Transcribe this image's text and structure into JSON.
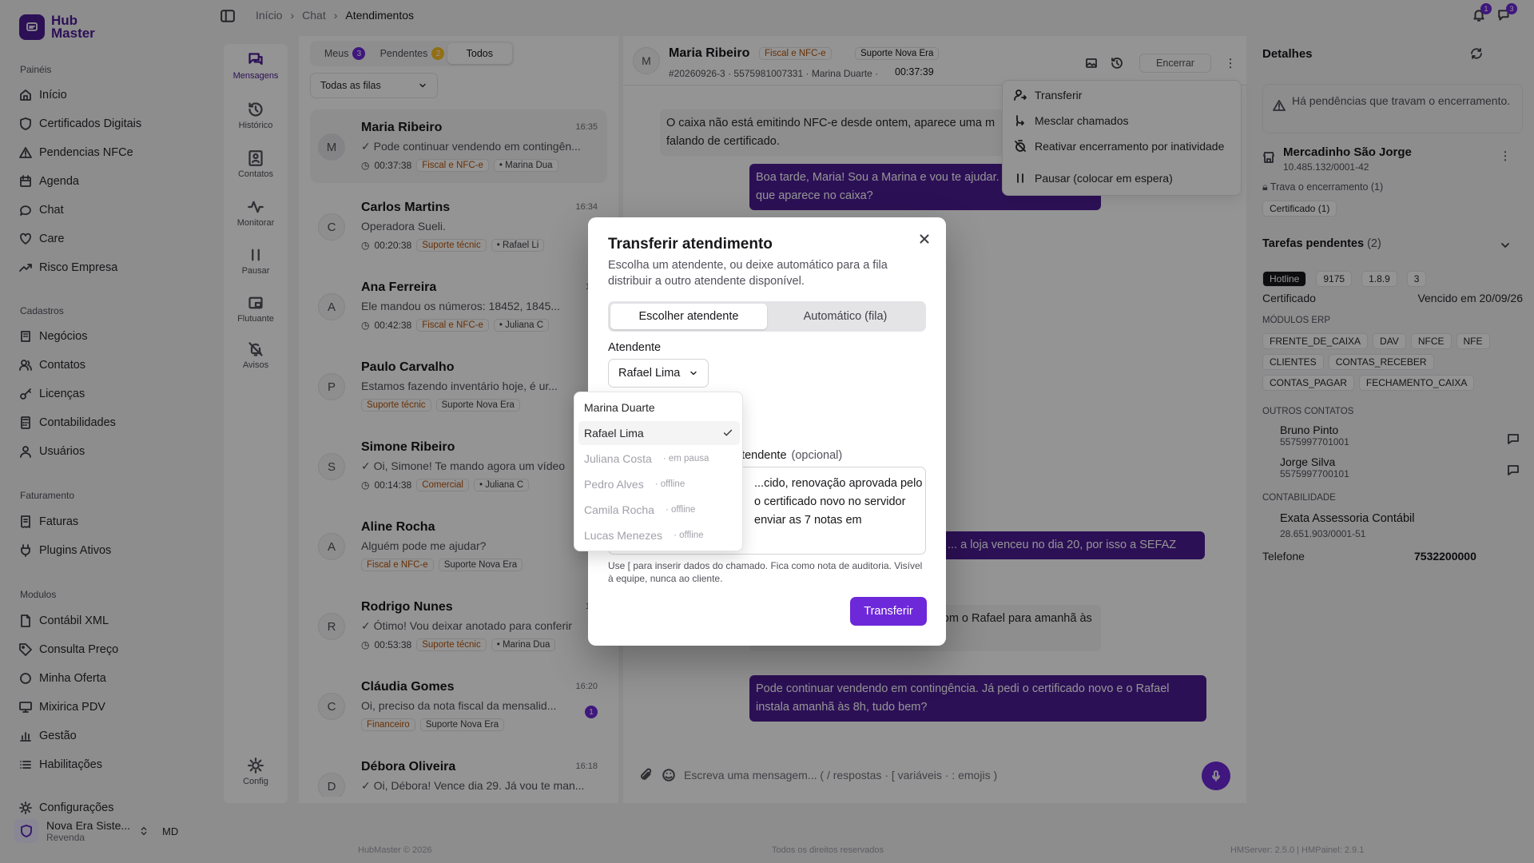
{
  "brand": {
    "line1": "Hub",
    "line2": "Master"
  },
  "sidebar": {
    "sections": [
      {
        "title": "Painéis",
        "items": [
          {
            "label": "Início",
            "icon": "home-icon"
          },
          {
            "label": "Certificados Digitais",
            "icon": "shield-icon"
          },
          {
            "label": "Pendencias NFCe",
            "icon": "alert-icon"
          },
          {
            "label": "Agenda",
            "icon": "calendar-icon"
          },
          {
            "label": "Chat",
            "icon": "chat-icon"
          },
          {
            "label": "Care",
            "icon": "heart-icon"
          },
          {
            "label": "Risco Empresa",
            "icon": "trend-icon"
          }
        ]
      },
      {
        "title": "Cadastros",
        "items": [
          {
            "label": "Negócios",
            "icon": "building-icon"
          },
          {
            "label": "Contatos",
            "icon": "users-icon"
          },
          {
            "label": "Licenças",
            "icon": "key-icon"
          },
          {
            "label": "Contabilidades",
            "icon": "calculator-icon"
          },
          {
            "label": "Usuários",
            "icon": "user-icon"
          }
        ]
      },
      {
        "title": "Faturamento",
        "items": [
          {
            "label": "Faturas",
            "icon": "receipt-icon"
          },
          {
            "label": "Plugins Ativos",
            "icon": "plug-icon"
          }
        ]
      },
      {
        "title": "Modulos",
        "items": [
          {
            "label": "Contábil XML",
            "icon": "file-icon"
          },
          {
            "label": "Consulta Preço",
            "icon": "tag-icon"
          },
          {
            "label": "Minha Oferta",
            "icon": "gift-icon"
          },
          {
            "label": "Mixirica PDV",
            "icon": "monitor-icon"
          },
          {
            "label": "Gestão",
            "icon": "chart-icon"
          },
          {
            "label": "Habilitações",
            "icon": "list-icon"
          },
          {
            "label": "Configurações",
            "icon": "gear-icon"
          }
        ]
      }
    ],
    "workspace": {
      "name": "Nova Era Siste...",
      "role": "Revenda",
      "initials": "MD"
    }
  },
  "topbar": {
    "crumbs": [
      "Início",
      "Chat",
      "Atendimentos"
    ],
    "notif_count": "1",
    "msg_count": "3"
  },
  "rail": [
    {
      "label": "Mensagens",
      "icon": "message-icon"
    },
    {
      "label": "Histórico",
      "icon": "history-icon"
    },
    {
      "label": "Contatos",
      "icon": "contacts-icon"
    },
    {
      "label": "Monitorar",
      "icon": "activity-icon"
    },
    {
      "label": "Pausar",
      "icon": "pause-icon"
    },
    {
      "label": "Flutuante",
      "icon": "float-icon"
    },
    {
      "label": "Avisos",
      "icon": "bell-off-icon"
    },
    {
      "label": "Config",
      "icon": "gear-icon"
    }
  ],
  "list": {
    "tabs": [
      {
        "label": "Meus",
        "badge": "3"
      },
      {
        "label": "Pendentes",
        "badge": "2"
      },
      {
        "label": "Todos",
        "badge": ""
      }
    ],
    "filter": "Todas as filas",
    "conversations": [
      {
        "initial": "M",
        "name": "Maria Ribeiro",
        "time": "16:35",
        "preview": "✓ Pode continuar vendendo em contingên...",
        "timer": "00:37:38",
        "tag": "Fiscal e NFC-e",
        "agent": "• Marina Dua"
      },
      {
        "initial": "C",
        "name": "Carlos Martins",
        "time": "16:34",
        "preview": "Operadora Sueli.",
        "timer": "00:20:38",
        "tag": "Suporte técnic",
        "agent": "• Rafael Li"
      },
      {
        "initial": "A",
        "name": "Ana Ferreira",
        "time": "16:",
        "preview": "Ele mandou os números: 18452, 1845...",
        "timer": "00:42:38",
        "tag": "Fiscal e NFC-e",
        "agent": "• Juliana C"
      },
      {
        "initial": "P",
        "name": "Paulo Carvalho",
        "time": "",
        "preview": "Estamos fazendo inventário hoje, é ur...",
        "timer": "",
        "tag": "Suporte técnic",
        "agent": "Suporte Nova Era"
      },
      {
        "initial": "S",
        "name": "Simone Ribeiro",
        "time": "",
        "preview": "✓ Oi, Simone! Te mando agora um vídeo",
        "timer": "00:14:38",
        "tag": "Comercial",
        "agent": "• Juliana C"
      },
      {
        "initial": "A",
        "name": "Aline Rocha",
        "time": "",
        "preview": "Alguém pode me ajudar?",
        "timer": "",
        "tag": "Fiscal e NFC-e",
        "agent": "Suporte Nova Era"
      },
      {
        "initial": "R",
        "name": "Rodrigo Nunes",
        "time": "16:",
        "preview": "✓ Ótimo! Vou deixar anotado para conferir",
        "timer": "00:53:38",
        "tag": "Suporte técnic",
        "agent": "• Marina Dua"
      },
      {
        "initial": "C",
        "name": "Cláudia Gomes",
        "time": "16:20",
        "preview": "Oi, preciso da nota fiscal da mensalid...",
        "timer": "",
        "tag": "Financeiro",
        "agent": "Suporte Nova Era",
        "unread": "1"
      },
      {
        "initial": "D",
        "name": "Débora Oliveira",
        "time": "16:18",
        "preview": "✓ Oi, Débora! Vence dia 29. Já vou te man...",
        "timer": "",
        "tag": "",
        "agent": ""
      }
    ]
  },
  "chat": {
    "initial": "M",
    "name": "Maria Ribeiro",
    "tag": "Fiscal e NFC-e",
    "queue": "Suporte Nova Era",
    "meta": "#20260926-3 · 5575981007331 · Marina Duarte ·",
    "timer": "00:37:39",
    "close_label": "Encerrar",
    "messages": [
      {
        "text": "O caixa não está emitindo NFC-e desde ontem, aparece uma m falando de certificado."
      },
      {
        "text": "Boa tarde, Maria! Sou a Marina e vou te ajudar. da mensagem que aparece no caixa?"
      },
      {
        "text": "... a loja venceu no dia 20, por isso a SEFAZ"
      },
      {
        "text": "Jorge (dono) autorizou a ...endada com o Rafael para amanhã às 8h."
      },
      {
        "text": "Pode continuar vendendo em contingência. Já pedi o certificado novo e o Rafael instala amanhã às 8h, tudo bem?"
      }
    ],
    "composer_placeholder": "Escreva uma mensagem...  ( / respostas · [ variáveis · : emojis )",
    "actions": [
      "Transferir",
      "Mesclar chamados",
      "Reativar encerramento por inatividade",
      "Pausar (colocar em espera)"
    ]
  },
  "details": {
    "title": "Detalhes",
    "warning": "Há pendências que travam o encerramento.",
    "company": "Mercadinho São Jorge",
    "cnpj": "10.485.132/0001-42",
    "lock": "Trava o encerramento (1)",
    "cert_chip": "Certificado (1)",
    "tasks_title": "Tarefas pendentes",
    "tasks_count": "(2)",
    "badges": [
      "Hotline",
      "9175",
      "1.8.9",
      "3"
    ],
    "cert_label": "Certificado",
    "cert_due": "Vencido em 20/09/26",
    "modules_title": "MÓDULOS ERP",
    "modules": [
      "FRENTE_DE_CAIXA",
      "DAV",
      "NFCE",
      "NFE",
      "CLIENTES",
      "CONTAS_RECEBER",
      "CONTAS_PAGAR",
      "FECHAMENTO_CAIXA"
    ],
    "others_title": "OUTROS CONTATOS",
    "contacts": [
      {
        "name": "Bruno Pinto",
        "phone": "5575997701001"
      },
      {
        "name": "Jorge Silva",
        "phone": "5575997700101"
      }
    ],
    "acct_title": "CONTABILIDADE",
    "acct_name": "Exata Assessoria Contábil",
    "acct_cnpj": "28.651.903/0001-51",
    "phone_label": "Telefone",
    "phone": "7532200000"
  },
  "footer": {
    "left": "HubMaster © 2026",
    "center": "Todos os direitos reservados",
    "right": "HMServer: 2.5.0 | HMPainel: 2.9.1"
  },
  "modal": {
    "title": "Transferir atendimento",
    "description": "Escolha um atendente, ou deixe automático para a fila distribuir a outro atendente disponível.",
    "seg_manual": "Escolher atendente",
    "seg_auto": "Automático (fila)",
    "agent_label": "Atendente",
    "agent_value": "Rafael Lima",
    "note_label": "atendente",
    "note_optional": "(opcional)",
    "note_lines": [
      "...cido, renovação aprovada pelo",
      "o certificado novo no servidor",
      "enviar as 7 notas em"
    ],
    "help": "Use [ para inserir dados do chamado. Fica como nota de auditoria. Visível à equipe, nunca ao cliente.",
    "submit": "Transferir"
  },
  "agents": [
    {
      "name": "Marina Duarte",
      "status": "",
      "selected": false,
      "disabled": false
    },
    {
      "name": "Rafael Lima",
      "status": "",
      "selected": true,
      "disabled": false
    },
    {
      "name": "Juliana Costa",
      "status": "· em pausa",
      "selected": false,
      "disabled": true
    },
    {
      "name": "Pedro Alves",
      "status": "· offline",
      "selected": false,
      "disabled": true
    },
    {
      "name": "Camila Rocha",
      "status": "· offline",
      "selected": false,
      "disabled": true
    },
    {
      "name": "Lucas Menezes",
      "status": "· offline",
      "selected": false,
      "disabled": true
    }
  ],
  "colors": {
    "accent": "#6d28d9",
    "brand": "#4c1d95",
    "overlay": "rgba(0,0,0,0.42)"
  }
}
